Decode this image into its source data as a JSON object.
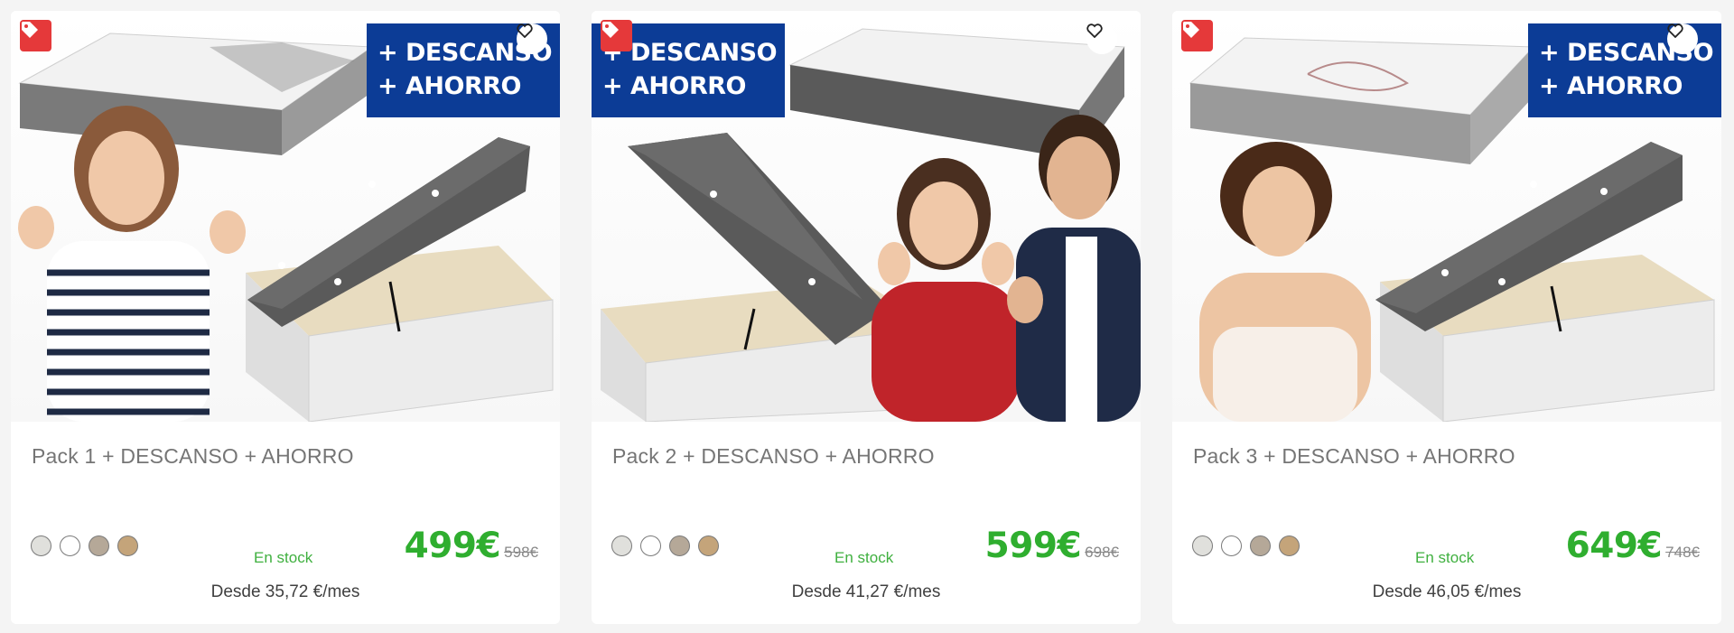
{
  "products": [
    {
      "title": "Pack 1 + DESCANSO + AHORRO",
      "promo": [
        "+ DESCANSO",
        "+ AHORRO"
      ],
      "stock": "En stock",
      "price": "499€",
      "old_price": "598€",
      "installment": "Desde 35,72 €/mes",
      "swatches": [
        "#e0e0dc",
        "#ffffff",
        "#b5a898",
        "#c4a47a"
      ]
    },
    {
      "title": "Pack 2 + DESCANSO + AHORRO",
      "promo": [
        "+ DESCANSO",
        "+ AHORRO"
      ],
      "stock": "En stock",
      "price": "599€",
      "old_price": "698€",
      "installment": "Desde 41,27 €/mes",
      "swatches": [
        "#e0e0dc",
        "#ffffff",
        "#b5a898",
        "#c4a47a"
      ]
    },
    {
      "title": "Pack 3 + DESCANSO + AHORRO",
      "promo": [
        "+ DESCANSO",
        "+ AHORRO"
      ],
      "stock": "En stock",
      "price": "649€",
      "old_price": "748€",
      "installment": "Desde 46,05 €/mes",
      "swatches": [
        "#e0e0dc",
        "#ffffff",
        "#b5a898",
        "#c4a47a"
      ]
    }
  ],
  "icons": {
    "tag": "tag-icon",
    "favorite": "heart-icon"
  },
  "colors": {
    "price": "#2fae2f",
    "stock": "#3fb03f",
    "promo_bg": "#0c3c96",
    "tag_bg": "#e5393a"
  }
}
